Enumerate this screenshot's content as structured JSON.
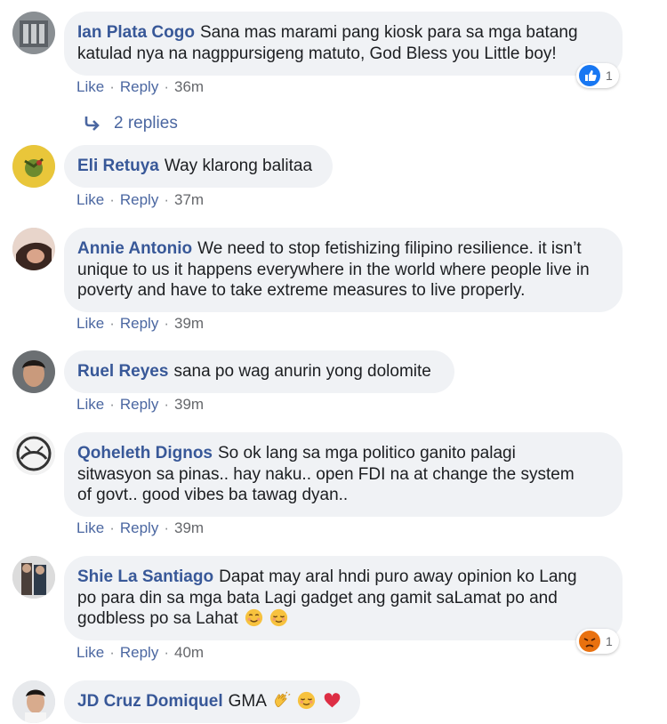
{
  "comments": [
    {
      "author": "Ian Plata Cogo",
      "text_line1": "Sana mas marami pang kiosk para sa mga batang",
      "text_line2": "katulad nya na nagppursigeng matuto, God Bless you Little boy!",
      "like": "Like",
      "reply": "Reply",
      "time": "36m",
      "reaction_count": "1",
      "reaction_icon": "like-icon",
      "replies_label": "2 replies"
    },
    {
      "author": "Eli Retuya",
      "text": "Way klarong balitaa",
      "like": "Like",
      "reply": "Reply",
      "time": "37m"
    },
    {
      "author": "Annie Antonio",
      "text_line1": "We need to stop fetishizing filipino resilience. it isn’t",
      "text_line2": "unique to us it happens everywhere in the world where people live in",
      "text_line3": "poverty and have to take extreme measures to live properly.",
      "like": "Like",
      "reply": "Reply",
      "time": "39m"
    },
    {
      "author": "Ruel Reyes",
      "text": "sana po wag anurin yong dolomite",
      "like": "Like",
      "reply": "Reply",
      "time": "39m"
    },
    {
      "author": "Qoheleth Dignos",
      "text_line1": "So ok lang sa mga politico ganito palagi",
      "text_line2": "sitwasyon sa pinas.. hay naku.. open FDI na at change the system",
      "text_line3": "of govt.. good vibes ba tawag dyan..",
      "like": "Like",
      "reply": "Reply",
      "time": "39m"
    },
    {
      "author": "Shie La Santiago",
      "text_line1": "Dapat may aral hndi puro away opinion ko Lang",
      "text_line2": "po para din sa mga bata Lagi gadget ang gamit saLamat po and",
      "text_line3": "godbless po sa Lahat",
      "emojis": [
        "smiling-face-icon",
        "relieved-face-icon"
      ],
      "like": "Like",
      "reply": "Reply",
      "time": "40m",
      "reaction_count": "1",
      "reaction_icon": "angry-icon"
    },
    {
      "author": "JD Cruz Domiquel",
      "text": "GMA",
      "emojis": [
        "clapping-hands-icon",
        "relieved-face-icon",
        "red-heart-icon"
      ]
    }
  ],
  "colors": {
    "author": "#385898",
    "bubble": "#f0f2f5",
    "action": "#4b67a1",
    "meta": "#65676b",
    "like_reaction": "#1877f2",
    "angry_reaction": "#e9710f"
  }
}
